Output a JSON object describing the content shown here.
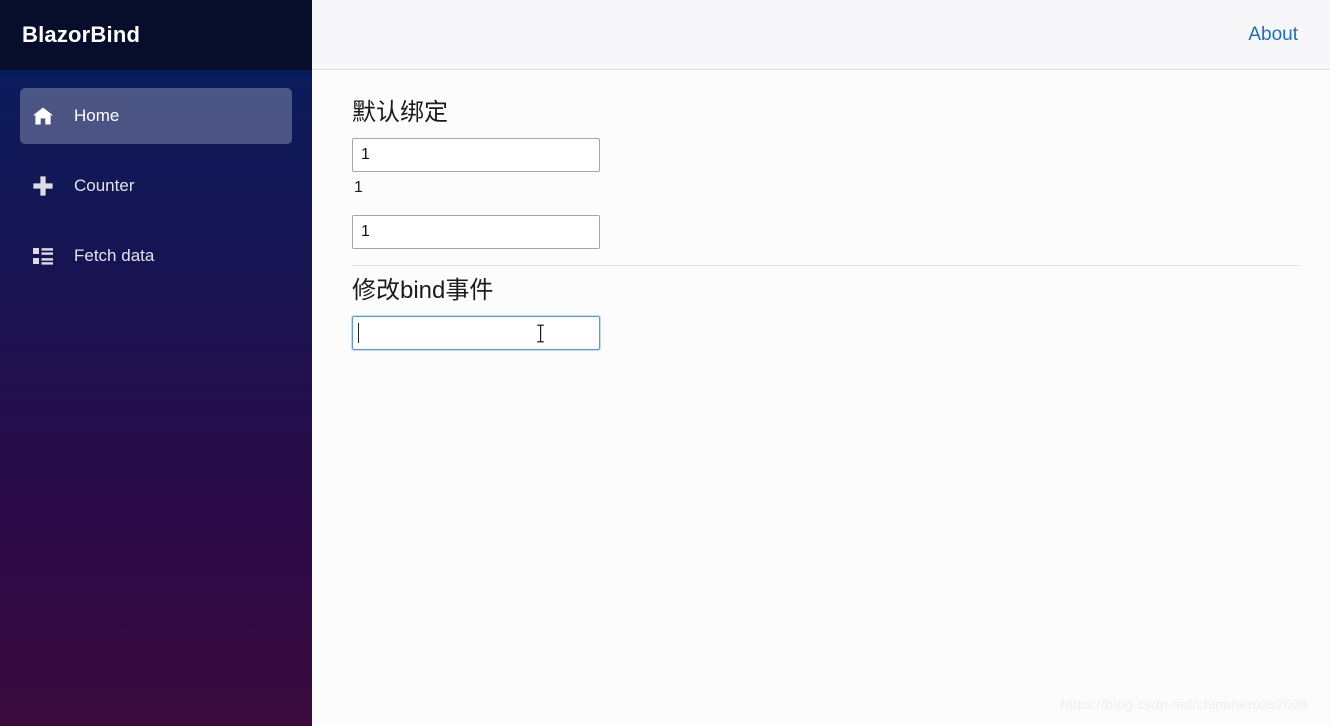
{
  "app": {
    "brand_title": "BlazorBind",
    "accent_link_color": "#1b6ec2",
    "sidebar_gradient_from": "#051e5f",
    "sidebar_gradient_to": "#3a0a3d"
  },
  "sidebar": {
    "items": [
      {
        "label": "Home",
        "icon": "home-icon",
        "active": true
      },
      {
        "label": "Counter",
        "icon": "plus-icon",
        "active": false
      },
      {
        "label": "Fetch data",
        "icon": "list-icon",
        "active": false
      }
    ]
  },
  "topbar": {
    "about_label": "About"
  },
  "main": {
    "sections": [
      {
        "heading": "默认绑定",
        "input_one_value": "1",
        "echo_value": "1",
        "input_two_value": "1"
      },
      {
        "heading": "修改bind事件",
        "input_value": "",
        "input_placeholder": ""
      }
    ]
  },
  "watermark": {
    "text": "https://blog.csdn.net/chinaherolts2008"
  }
}
